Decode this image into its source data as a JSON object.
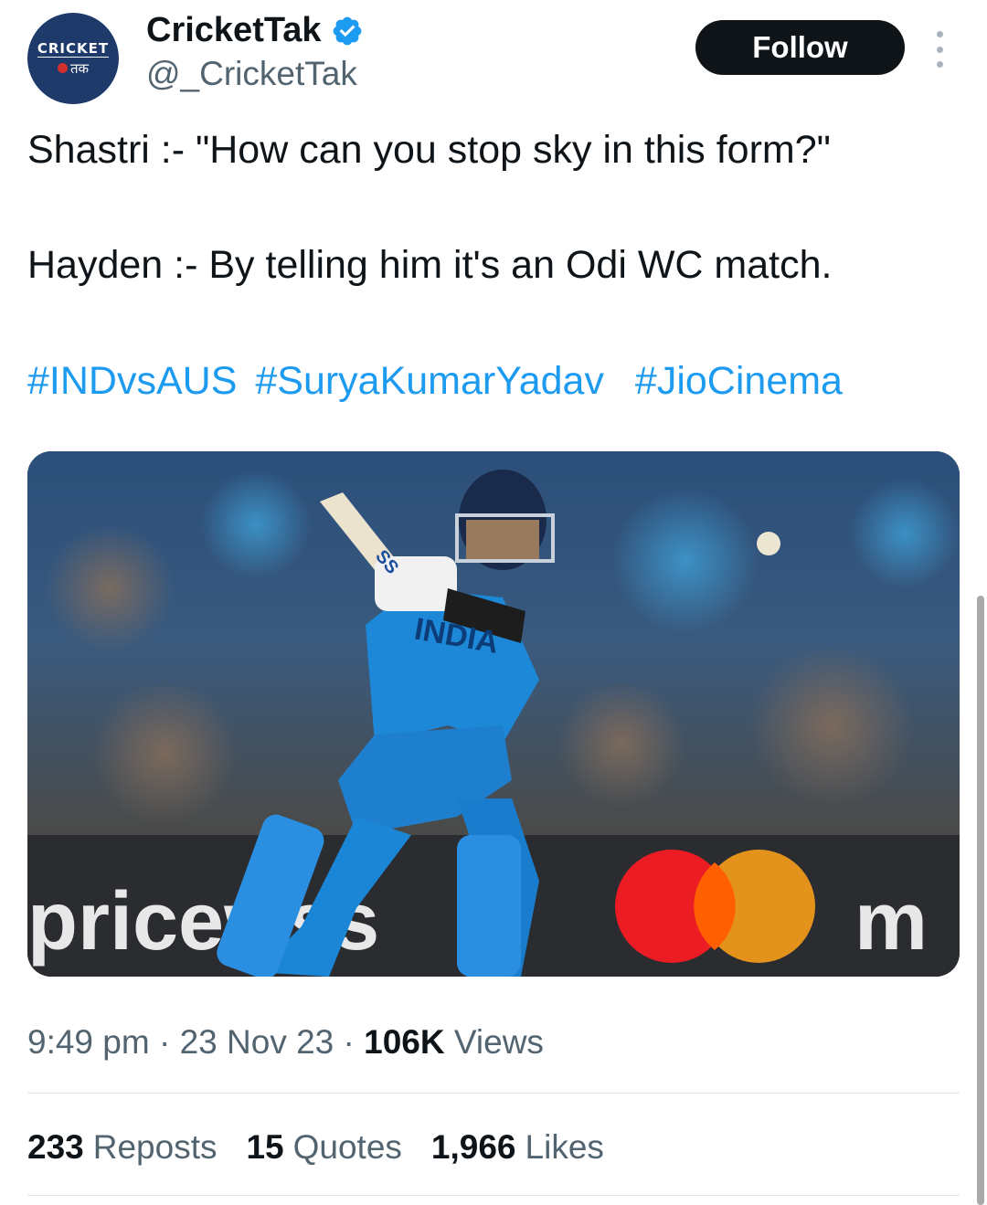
{
  "account": {
    "display_name": "CricketTak",
    "handle": "@_CricketTak",
    "avatar_line1": "CRICKET",
    "avatar_line2": "तक",
    "verified": true
  },
  "follow_label": "Follow",
  "tweet": {
    "line1": "Shastri :- \"How can you stop sky in this form?\"",
    "line2": "Hayden :- By telling him it's an Odi WC match.",
    "hashtags": [
      "#INDvsAUS",
      "#SuryaKumarYadav",
      "#JioCinema"
    ]
  },
  "media": {
    "jersey_text": "INDIA",
    "bat_logo": "SS",
    "hoarding_left": "pricewss",
    "hoarding_right": "m"
  },
  "meta": {
    "time": "9:49 pm",
    "sep1": " · ",
    "date": "23 Nov 23",
    "sep2": " · ",
    "views_count": "106K",
    "views_label": "Views"
  },
  "stats": {
    "reposts_count": "233",
    "reposts_label": "Reposts",
    "quotes_count": "15",
    "quotes_label": "Quotes",
    "likes_count": "1,966",
    "likes_label": "Likes"
  },
  "colors": {
    "link": "#1d9bf0",
    "text": "#0f1419",
    "muted": "#536471",
    "verified": "#1d9bf0",
    "button": "#0f1419"
  }
}
